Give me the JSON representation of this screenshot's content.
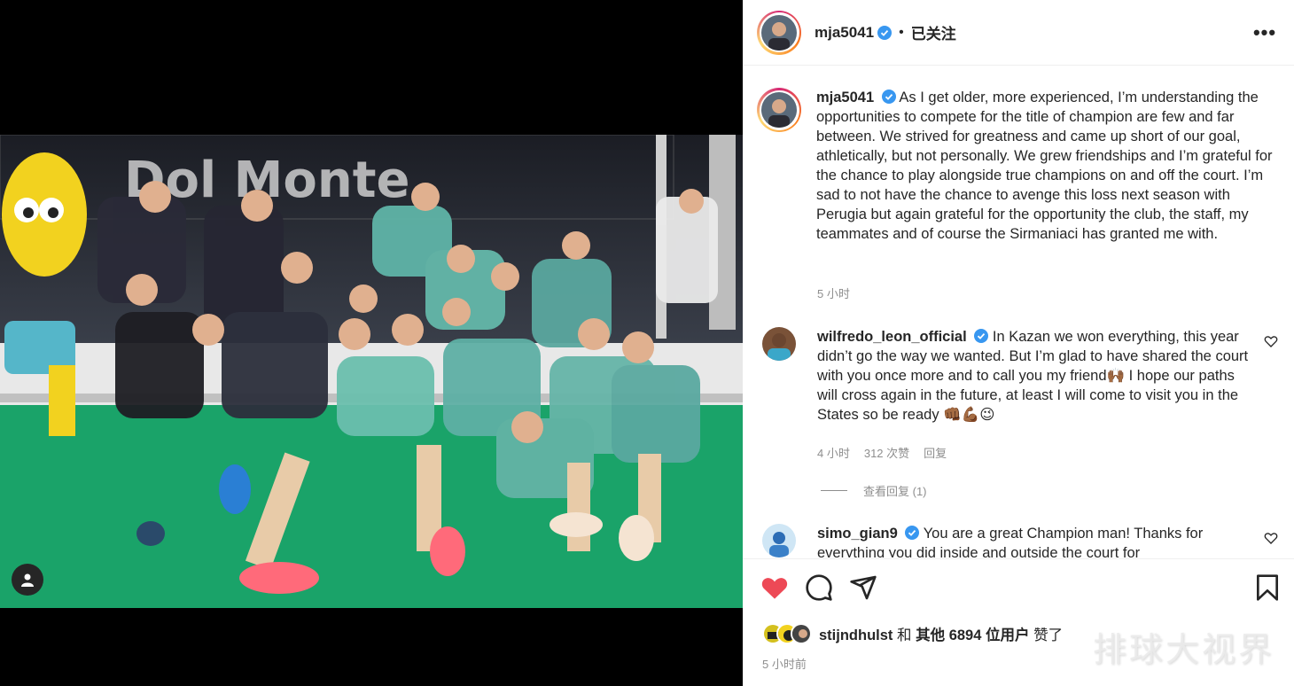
{
  "post": {
    "username": "mja5041",
    "follow_status": "已关注",
    "separator": "•",
    "more_label": "•••"
  },
  "caption": {
    "username": "mja5041",
    "text": "As I get older, more experienced, I’m understanding the opportunities to compete for the title of champion are few and far between. We strived for greatness and came up short of our goal, athletically, but not personally. We grew friendships and I’m grateful for the chance to play alongside true champions on and off the court. I’m sad to not have the chance to avenge this loss next season with Perugia but again grateful for the opportunity the club, the staff, my teammates and of course the Sirmaniaci has granted me with.",
    "time": "5 小时"
  },
  "comments": [
    {
      "username": "wilfredo_leon_official",
      "text": "In Kazan we won everything, this year didn’t go the way we wanted. But I’m glad to have shared the court with you once more and to call you my friend🙌🏾 I hope our paths will cross again in the future, at least I will come to visit you in the States so be ready 👊🏾💪🏾😉",
      "time": "4 小时",
      "likes": "312 次赞",
      "reply": "回复",
      "view_replies": "查看回复 (1)"
    },
    {
      "username": "simo_gian9",
      "text": "You are a great Champion man! Thanks for everything you did inside and outside the court for"
    }
  ],
  "likes": {
    "user": "stijndhulst",
    "connector": "和",
    "others": "其他 6894 位用户",
    "suffix": "赞了"
  },
  "post_time": "5 小时前",
  "watermark": "排球大视界",
  "colors": {
    "heart": "#ed4956",
    "verified": "#3897f0",
    "court_green": "#1aa369",
    "meta_gray": "#8e8e8e"
  },
  "icons": [
    "verified-icon",
    "more-icon",
    "heart-icon",
    "comment-icon",
    "share-icon",
    "bookmark-icon",
    "user-tag-icon"
  ]
}
